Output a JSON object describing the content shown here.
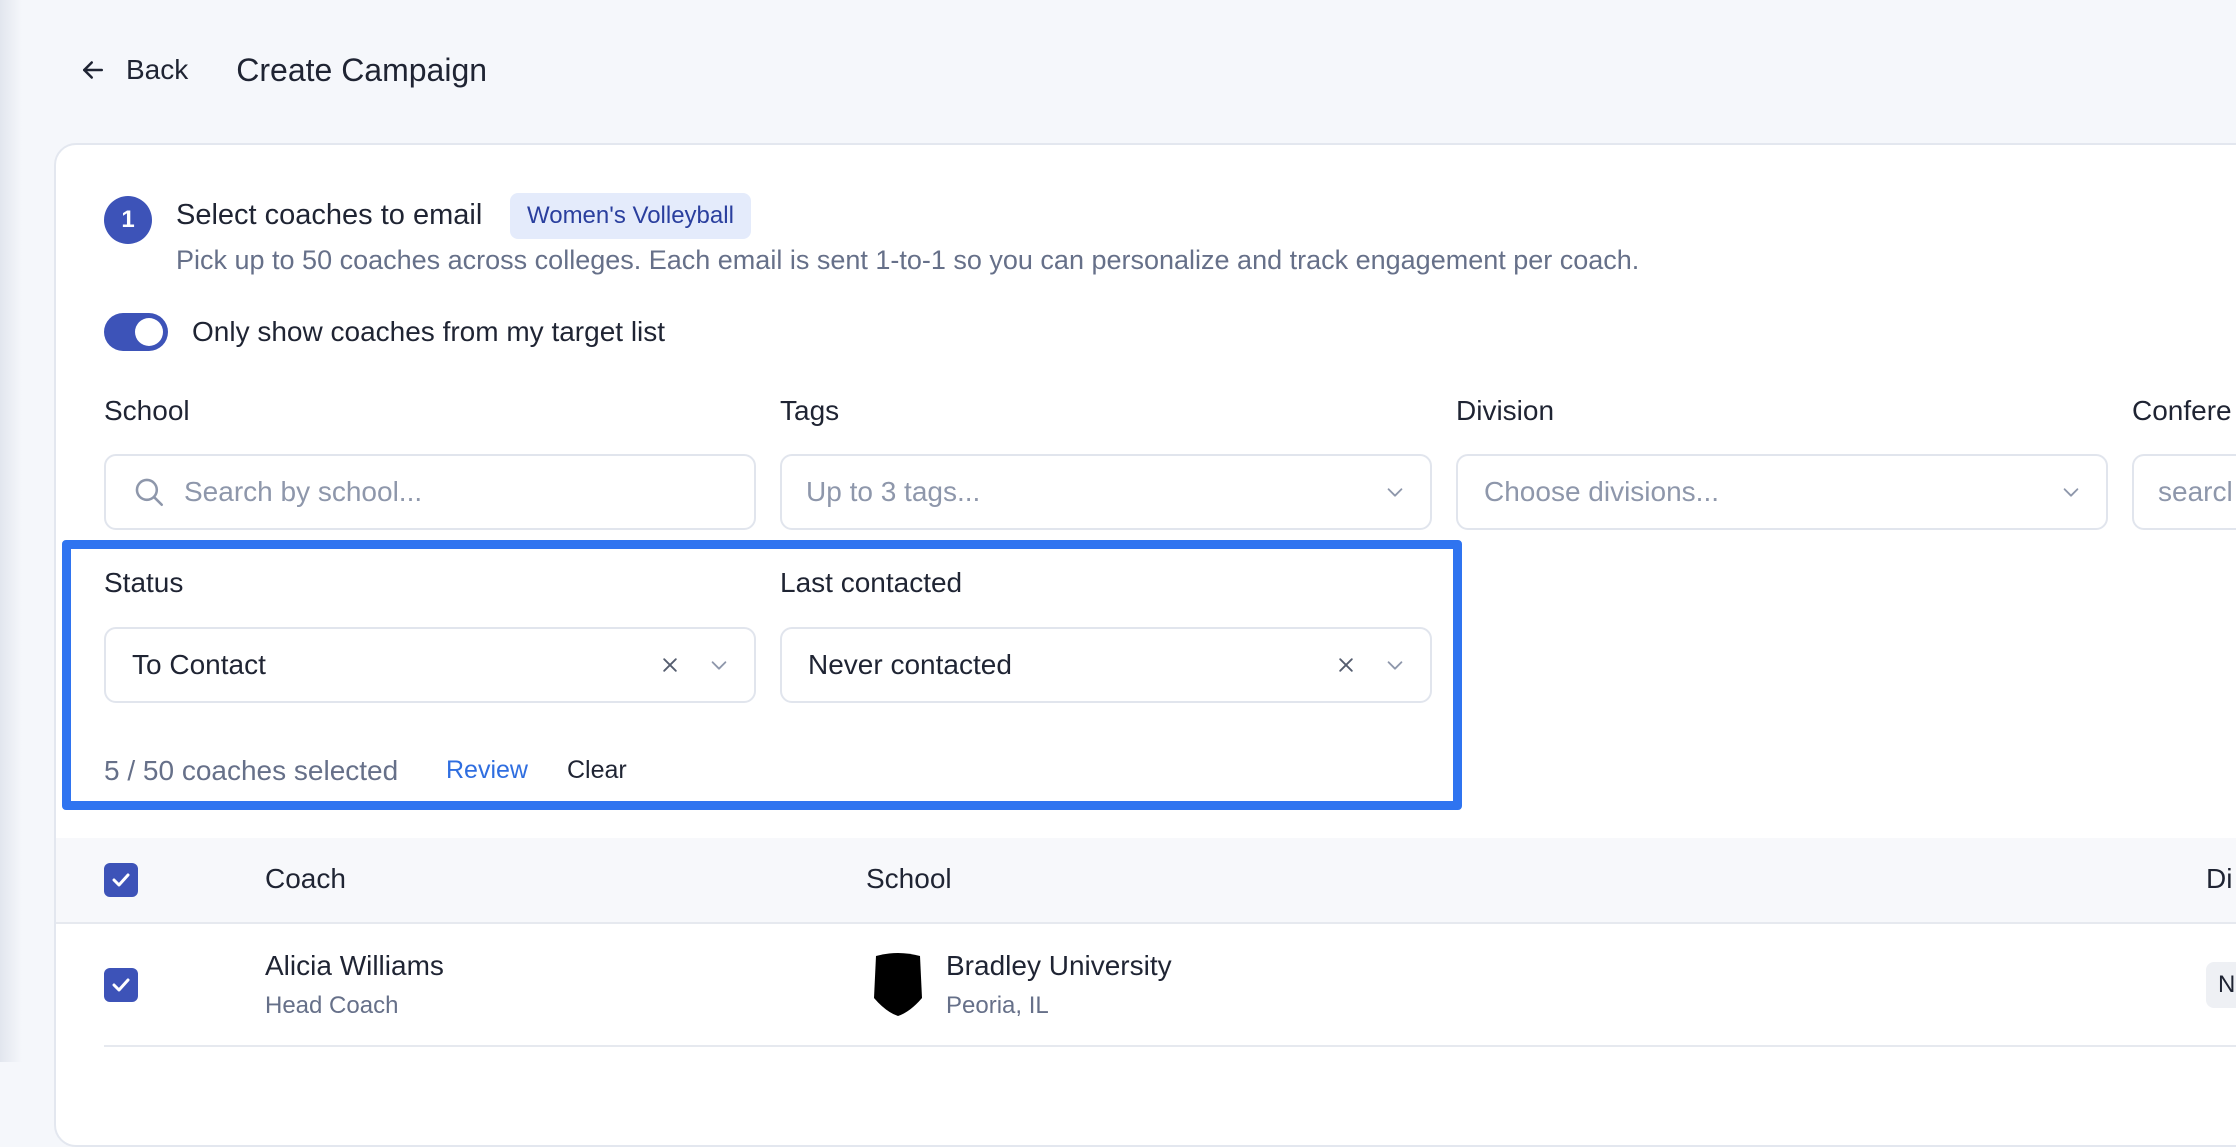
{
  "header": {
    "back_label": "Back",
    "title": "Create Campaign"
  },
  "step": {
    "number": "1",
    "title": "Select coaches to email",
    "sport_tag": "Women's Volleyball",
    "description": "Pick up to 50 coaches across colleges. Each email is sent 1-to-1 so you can personalize and track engagement per coach."
  },
  "target_toggle": {
    "label": "Only show coaches from my target list",
    "on": true
  },
  "filters": {
    "school": {
      "label": "School",
      "placeholder": "Search by school..."
    },
    "tags": {
      "label": "Tags",
      "placeholder": "Up to 3 tags..."
    },
    "division": {
      "label": "Division",
      "placeholder": "Choose divisions..."
    },
    "conference": {
      "label": "Confere",
      "placeholder": "searcl"
    },
    "status": {
      "label": "Status",
      "value": "To Contact"
    },
    "last_contacted": {
      "label": "Last contacted",
      "value": "Never contacted"
    }
  },
  "selection": {
    "count_text": "5 / 50 coaches selected",
    "review_label": "Review",
    "clear_label": "Clear"
  },
  "table": {
    "columns": {
      "coach": "Coach",
      "school": "School",
      "division": "Di"
    },
    "rows": [
      {
        "name": "Alicia Williams",
        "role": "Head Coach",
        "school": "Bradley University",
        "location": "Peoria, IL",
        "division": "N",
        "checked": true
      }
    ]
  },
  "colors": {
    "accent": "#3d53b8",
    "highlight": "#2f74f0",
    "link": "#2f6ee0"
  }
}
